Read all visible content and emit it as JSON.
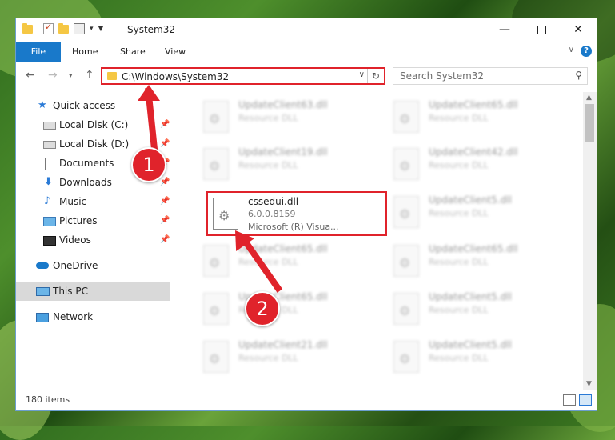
{
  "window": {
    "title": "System32"
  },
  "ribbon": {
    "tabs": [
      "File",
      "Home",
      "Share",
      "View"
    ],
    "help": "?"
  },
  "address": {
    "path": "C:\\Windows\\System32",
    "search_placeholder": "Search System32"
  },
  "sidebar": {
    "items": [
      {
        "label": "Quick access",
        "icon": "star-icon"
      },
      {
        "label": "Local Disk (C:)",
        "icon": "drive-icon"
      },
      {
        "label": "Local Disk (D:)",
        "icon": "drive-icon"
      },
      {
        "label": "Documents",
        "icon": "document-icon"
      },
      {
        "label": "Downloads",
        "icon": "download-icon"
      },
      {
        "label": "Music",
        "icon": "music-icon"
      },
      {
        "label": "Pictures",
        "icon": "pictures-icon"
      },
      {
        "label": "Videos",
        "icon": "video-icon"
      },
      {
        "label": "OneDrive",
        "icon": "cloud-icon"
      },
      {
        "label": "This PC",
        "icon": "computer-icon"
      },
      {
        "label": "Network",
        "icon": "network-icon"
      }
    ]
  },
  "files": [
    {
      "name": "UpdateClient63.dll",
      "desc": "Resource DLL"
    },
    {
      "name": "UpdateClient65.dll",
      "desc": "Resource DLL"
    },
    {
      "name": "UpdateClient19.dll",
      "desc": "Resource DLL"
    },
    {
      "name": "UpdateClient42.dll",
      "desc": "Resource DLL"
    },
    {
      "name": "cssedui.dll",
      "version": "6.0.0.8159",
      "company": "Microsoft (R) Visua..."
    },
    {
      "name": "UpdateClient5.dll",
      "desc": "Resource DLL"
    },
    {
      "name": "UpdateClient65.dll",
      "desc": "Resource DLL"
    },
    {
      "name": "UpdateClient65.dll",
      "desc": "Resource DLL"
    },
    {
      "name": "UpdateClient65.dll",
      "desc": "Resource DLL"
    },
    {
      "name": "UpdateClient5.dll",
      "desc": "Resource DLL"
    },
    {
      "name": "UpdateClient21.dll",
      "desc": "Resource DLL"
    },
    {
      "name": "UpdateClient5.dll",
      "desc": "Resource DLL"
    }
  ],
  "status": {
    "item_count": "180 items"
  },
  "annotations": {
    "step1": "1",
    "step2": "2"
  },
  "colors": {
    "accent": "#1979ca",
    "highlight": "#e0232b"
  }
}
